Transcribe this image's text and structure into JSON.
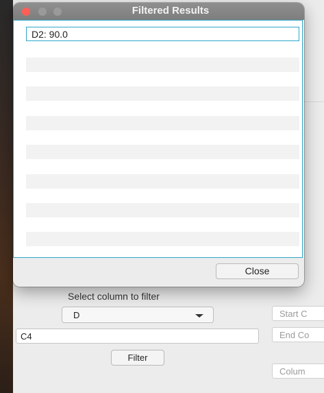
{
  "dialog": {
    "title": "Filtered Results",
    "results": [
      "D2: 90.0"
    ],
    "close_label": "Close"
  },
  "main": {
    "select_label": "Select column to filter",
    "column_value": "D",
    "value_input": "C4",
    "filter_label": "Filter",
    "side_fields": [
      "Start C",
      "End Co",
      "Colum"
    ]
  }
}
